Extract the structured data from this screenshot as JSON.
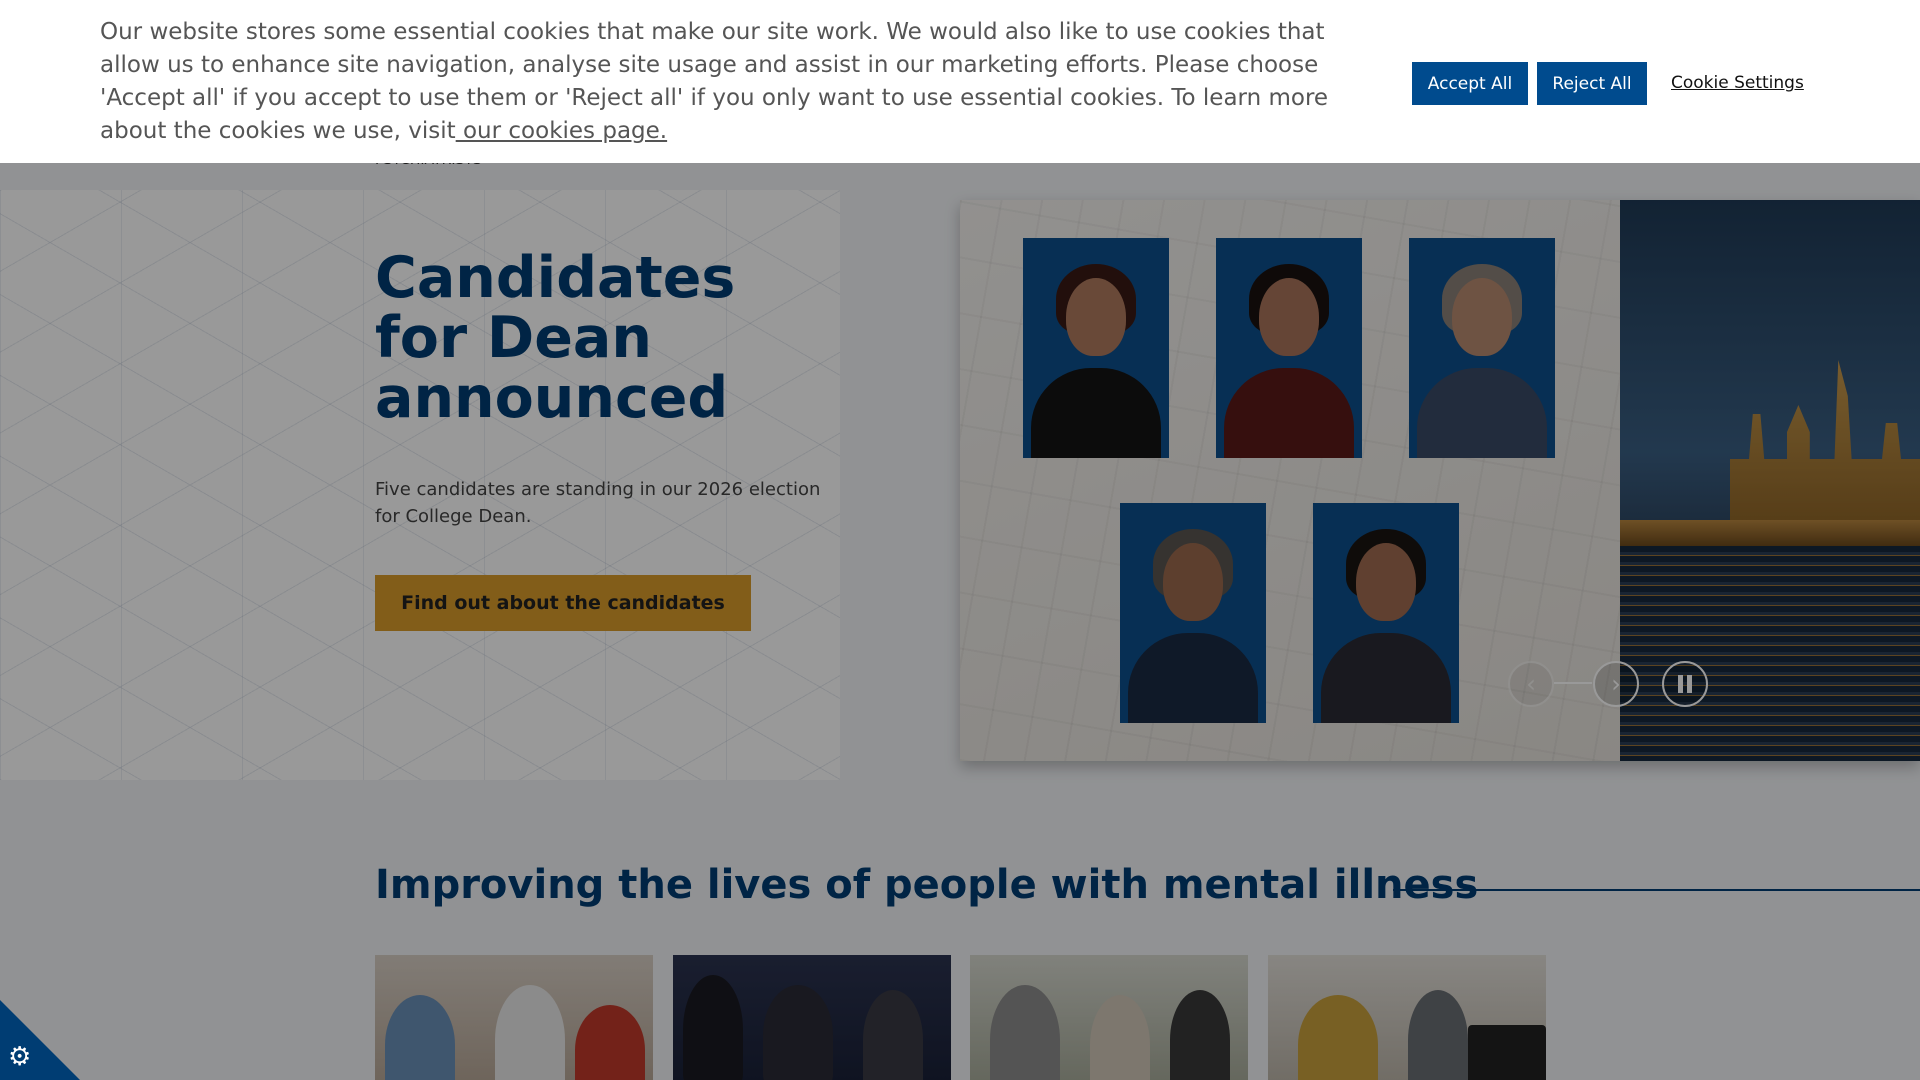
{
  "header": {
    "breadcrumb_stub": "PSYCHIATRISTS"
  },
  "hero": {
    "title": "Candidates for Dean announced",
    "text": "Five candidates are standing in our 2026 election for College Dean.",
    "cta_label": "Find out about the candidates"
  },
  "carousel": {
    "prev_icon": "chevron-left-icon",
    "next_icon": "chevron-right-icon",
    "pause_icon": "pause-icon",
    "prev_glyph": "‹",
    "next_glyph": "›"
  },
  "section": {
    "title": "Improving the lives of people with mental illness"
  },
  "cookie_banner": {
    "text": "Our website stores some essential cookies that make our site work. We would also like to use cookies that allow us to enhance site navigation, analyse site usage and assist in our marketing efforts. Please choose 'Accept all' if you accept to use them or 'Reject all' if you only want to use essential cookies. To learn more about the cookies we use, visit",
    "link_text": " our cookies page.",
    "accept_label": "Accept All",
    "reject_label": "Reject All",
    "settings_label": "Cookie Settings",
    "gear_glyph": "⚙"
  },
  "colors": {
    "brand_navy": "#003d73",
    "button_blue": "#004b8e",
    "cta_gold": "#d99b2b"
  }
}
